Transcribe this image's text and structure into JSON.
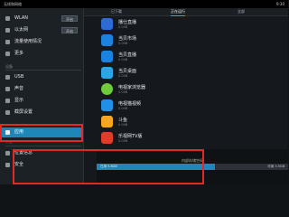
{
  "statusbar": {
    "title": "无线和网络",
    "right": "9:30"
  },
  "sidebar": {
    "items": [
      {
        "label": "WLAN",
        "toggle": "开启"
      },
      {
        "label": "以太网",
        "toggle": "开启"
      },
      {
        "label": "流量使用情况"
      },
      {
        "label": "更多"
      }
    ],
    "section_device": "设备",
    "device_items": [
      {
        "label": "USB"
      },
      {
        "label": "声音"
      },
      {
        "label": "显示"
      },
      {
        "label": "截屏设置"
      },
      {
        "label": "应用"
      }
    ],
    "section_personal": "个人",
    "personal_items": [
      {
        "label": "位置信息"
      },
      {
        "label": "安全"
      }
    ]
  },
  "tabs": [
    {
      "label": "已下载"
    },
    {
      "label": "正在运行"
    },
    {
      "label": "全部"
    }
  ],
  "apps": [
    {
      "name": "播仕直播",
      "size": "0.00B",
      "color": "#2f6bd6"
    },
    {
      "name": "当贝市场",
      "size": "0.00B",
      "color": "#1c82e0"
    },
    {
      "name": "当贝直播",
      "size": "0.00B",
      "color": "#1c82e0"
    },
    {
      "name": "当贝桌面",
      "size": "0.00B",
      "color": "#2aa7e8"
    },
    {
      "name": "电视家浏览器",
      "size": "0.00B",
      "color": "#6fcb3a"
    },
    {
      "name": "电视猫视频",
      "size": "0.00B",
      "color": "#1f8fe8"
    },
    {
      "name": "斗鱼",
      "size": "0.00B",
      "color": "#f5a623"
    },
    {
      "name": "乐视网TV版",
      "size": "0.00B",
      "color": "#e23b2a"
    }
  ],
  "storage": {
    "label": "内部存储空间",
    "used": "已用 5.8GB",
    "free": "可用 3.5GB",
    "used_fraction": 0.62,
    "fill_color": "#1f86b8"
  }
}
